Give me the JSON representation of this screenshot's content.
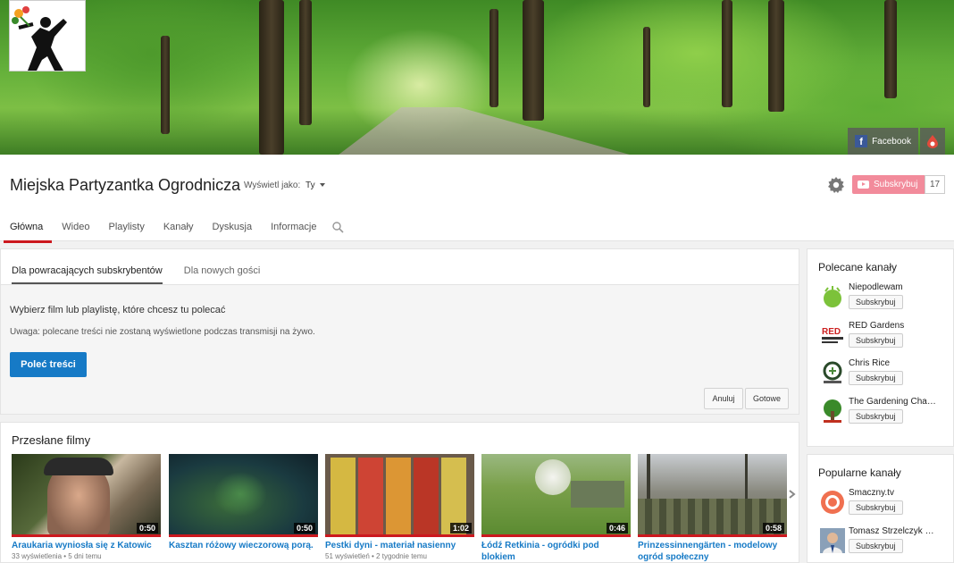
{
  "banner": {
    "social_links": [
      {
        "label": "Facebook",
        "icon": "facebook-icon"
      },
      {
        "label": "",
        "icon": "google-plus-icon"
      }
    ]
  },
  "channel": {
    "title": "Miejska Partyzantka Ogrodnicza",
    "view_as_label": "Wyświetl jako:",
    "view_as_value": "Ty",
    "subscribe_label": "Subskrybuj",
    "subscriber_count": "17"
  },
  "tabs": [
    "Główna",
    "Wideo",
    "Playlisty",
    "Kanały",
    "Dyskusja",
    "Informacje"
  ],
  "featured": {
    "subtabs": [
      "Dla powracających subskrybentów",
      "Dla nowych gości"
    ],
    "prompt": "Wybierz film lub playlistę, które chcesz tu polecać",
    "note": "Uwaga: polecane treści nie zostaną wyświetlone podczas transmisji na żywo.",
    "recommend_label": "Poleć treści",
    "cancel_label": "Anuluj",
    "done_label": "Gotowe"
  },
  "uploads": {
    "title": "Przesłane filmy",
    "videos": [
      {
        "title": "Araukaria wyniosła się z Katowic",
        "duration": "0:50",
        "meta": "33 wyświetlenia • 5 dni temu"
      },
      {
        "title": "Kasztan różowy wieczorową porą.",
        "duration": "0:50",
        "meta": ""
      },
      {
        "title": "Pestki dyni - materiał nasienny",
        "duration": "1:02",
        "meta": "51 wyświetleń • 2 tygodnie temu"
      },
      {
        "title": "Łódź Retkinia - ogródki pod blokiem",
        "duration": "0:46",
        "meta": ""
      },
      {
        "title": "Prinzessinnengärten - modelowy ogród społeczny",
        "duration": "0:58",
        "meta": ""
      }
    ]
  },
  "sidebar": {
    "featured_title": "Polecane kanały",
    "featured_channels": [
      {
        "name": "Niepodlewam",
        "button": "Subskrybuj"
      },
      {
        "name": "RED Gardens",
        "button": "Subskrybuj"
      },
      {
        "name": "Chris Rice",
        "button": "Subskrybuj"
      },
      {
        "name": "The Gardening Cha…",
        "button": "Subskrybuj"
      }
    ],
    "popular_title": "Popularne kanały",
    "popular_channels": [
      {
        "name": "Smaczny.tv",
        "button": "Subskrybuj"
      },
      {
        "name": "Tomasz Strzelczyk …",
        "button": "Subskrybuj"
      }
    ]
  },
  "colors": {
    "accent_red": "#cc181e",
    "link_blue": "#167ac6",
    "subscribe_pink": "#f28b9b"
  }
}
